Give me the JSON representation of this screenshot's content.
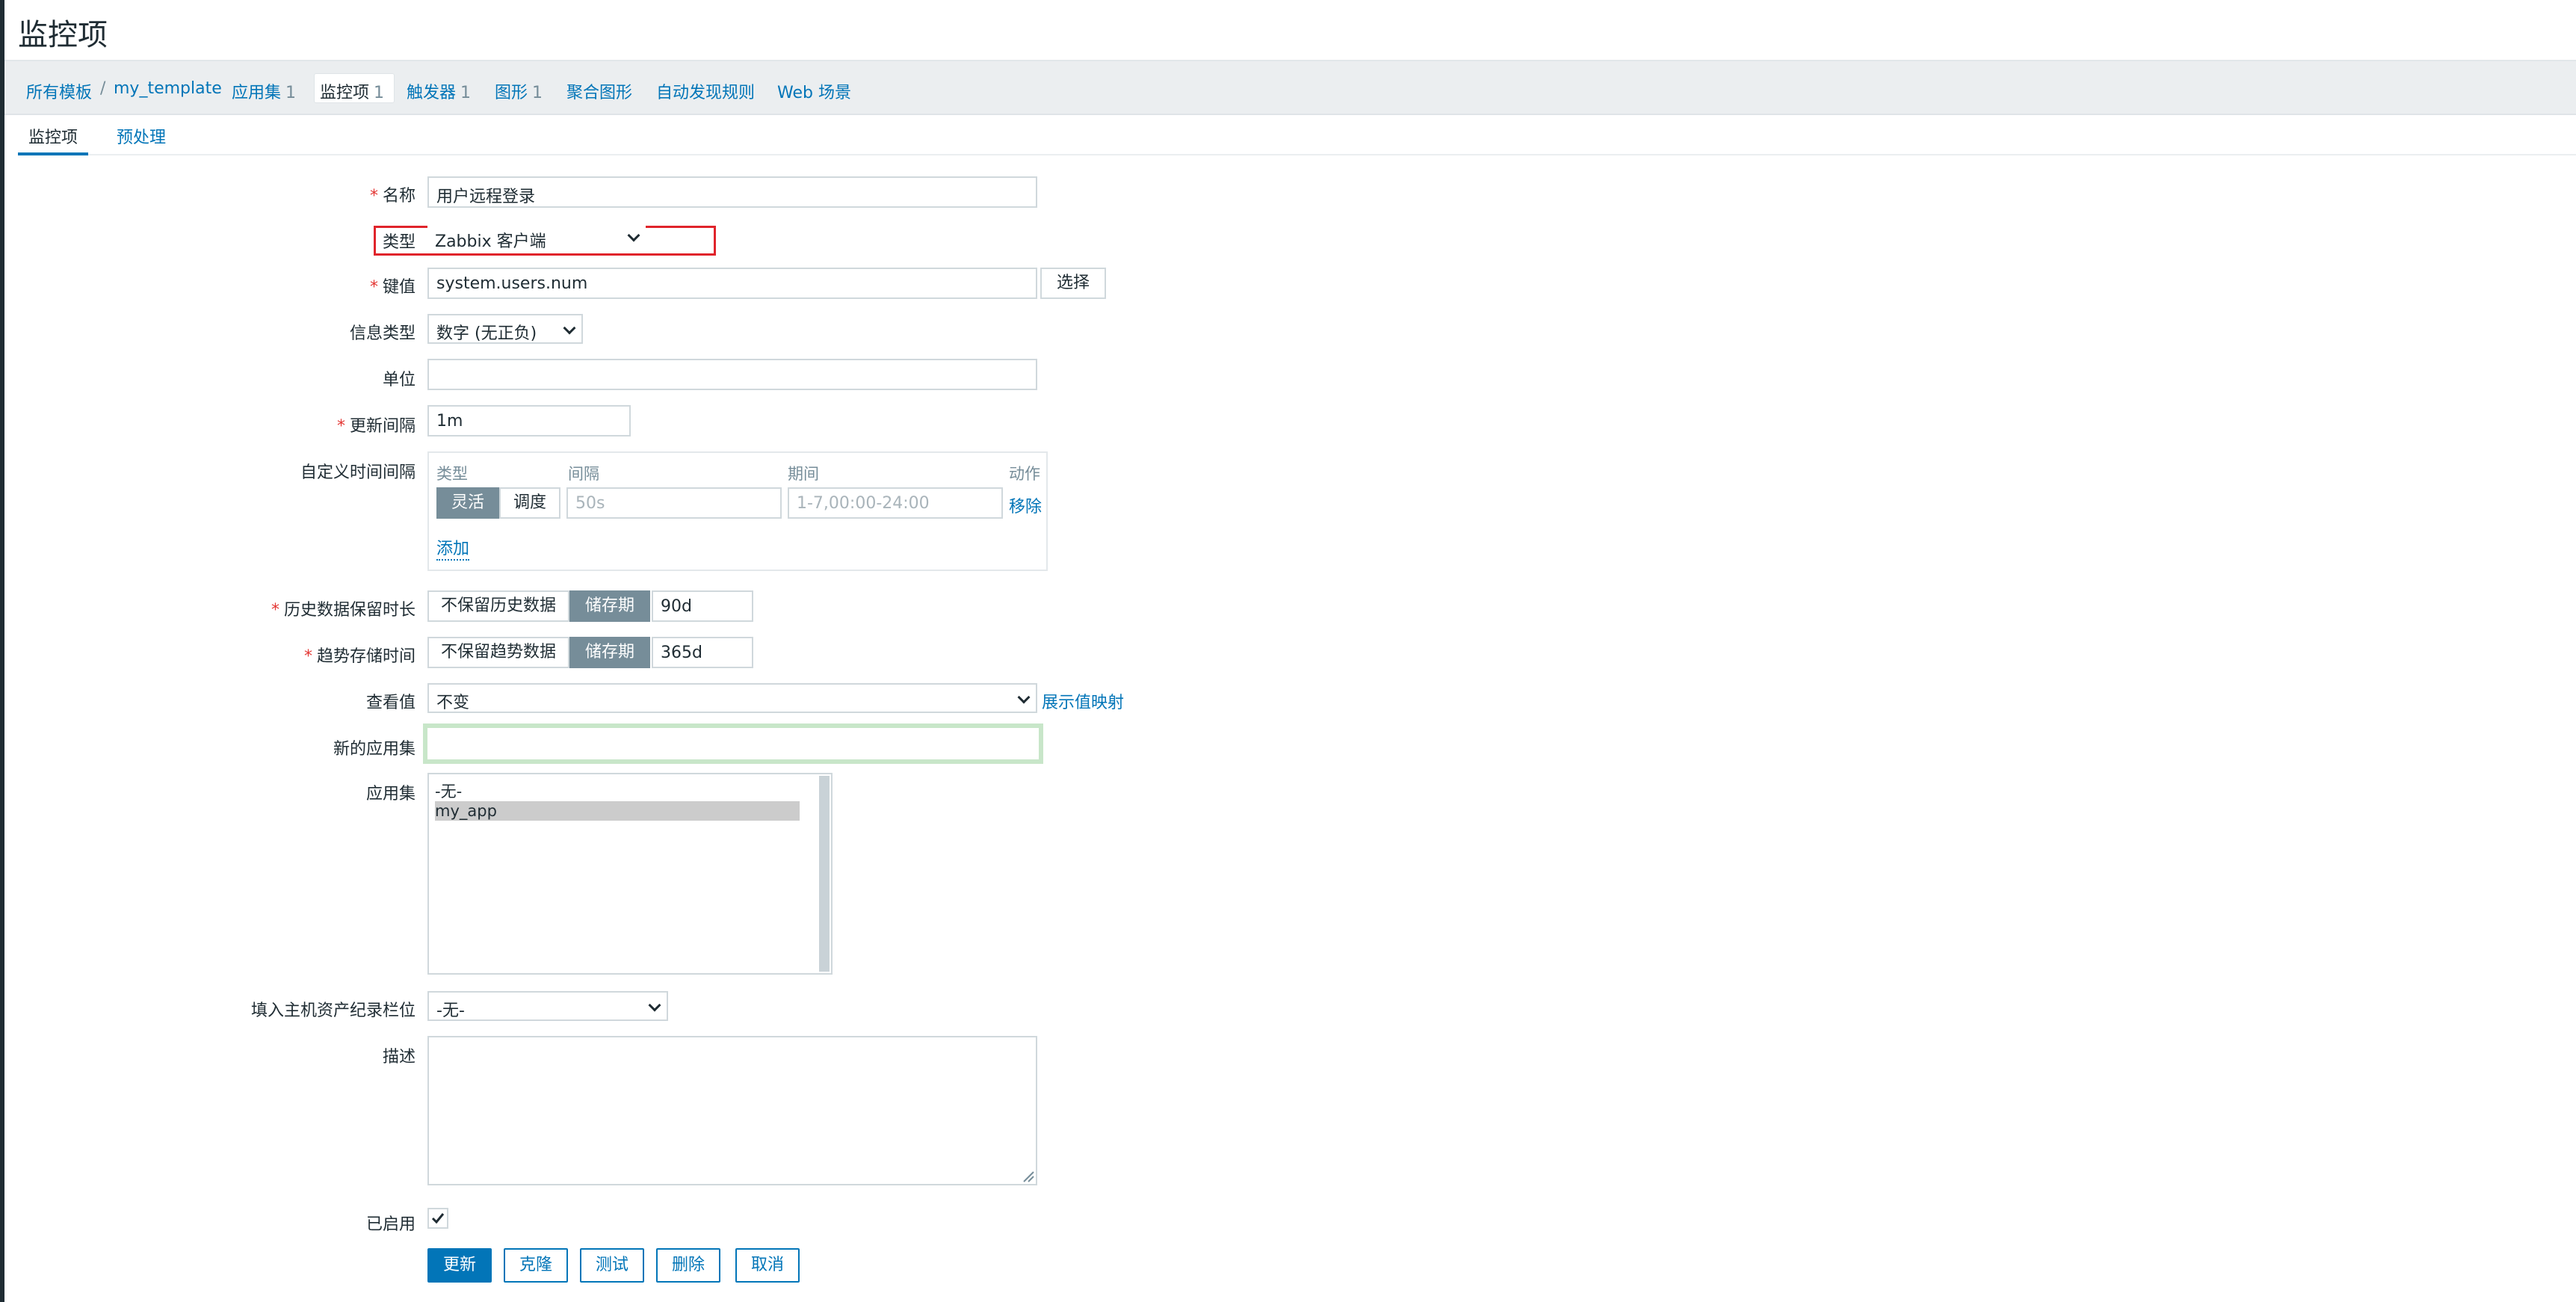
{
  "page": {
    "title": "监控项"
  },
  "breadcrumb": {
    "all_templates": "所有模板",
    "separator": "/",
    "template": "my_template",
    "items": [
      {
        "label": "应用集",
        "count": "1"
      },
      {
        "label": "监控项",
        "count": "1"
      },
      {
        "label": "触发器",
        "count": "1"
      },
      {
        "label": "图形",
        "count": "1"
      },
      {
        "label": "聚合图形",
        "count": ""
      },
      {
        "label": "自动发现规则",
        "count": ""
      },
      {
        "label": "Web 场景",
        "count": ""
      }
    ]
  },
  "tabs": {
    "item": "监控项",
    "preprocessing": "预处理"
  },
  "form": {
    "name": {
      "label": "名称",
      "value": "用户远程登录"
    },
    "type": {
      "label": "类型",
      "value": "Zabbix 客户端"
    },
    "key": {
      "label": "键值",
      "value": "system.users.num",
      "select_button": "选择"
    },
    "info_type": {
      "label": "信息类型",
      "value": "数字 (无正负)"
    },
    "units": {
      "label": "单位",
      "value": ""
    },
    "update_interval": {
      "label": "更新间隔",
      "value": "1m"
    },
    "custom_intervals": {
      "label": "自定义时间间隔",
      "headers": {
        "type": "类型",
        "interval": "间隔",
        "period": "期间",
        "action": "动作"
      },
      "row": {
        "flexible": "灵活",
        "scheduling": "调度",
        "interval_placeholder": "50s",
        "period_placeholder": "1-7,00:00-24:00",
        "remove": "移除"
      },
      "add": "添加"
    },
    "history": {
      "label": "历史数据保留时长",
      "option_off": "不保留历史数据",
      "option_on": "储存期",
      "value": "90d"
    },
    "trends": {
      "label": "趋势存储时间",
      "option_off": "不保留趋势数据",
      "option_on": "储存期",
      "value": "365d"
    },
    "valuemap": {
      "label": "查看值",
      "value": "不变",
      "link": "展示值映射"
    },
    "new_application": {
      "label": "新的应用集",
      "value": ""
    },
    "applications": {
      "label": "应用集",
      "options": [
        "-无-",
        "my_app"
      ],
      "selected": "my_app"
    },
    "inventory": {
      "label": "填入主机资产纪录栏位",
      "value": "-无-"
    },
    "description": {
      "label": "描述",
      "value": ""
    },
    "enabled": {
      "label": "已启用",
      "checked": true
    }
  },
  "buttons": {
    "update": "更新",
    "clone": "克隆",
    "test": "测试",
    "delete": "删除",
    "cancel": "取消"
  },
  "colors": {
    "accent": "#0275b8",
    "highlight": "#e0242b",
    "focus": "#c8e6c9"
  }
}
